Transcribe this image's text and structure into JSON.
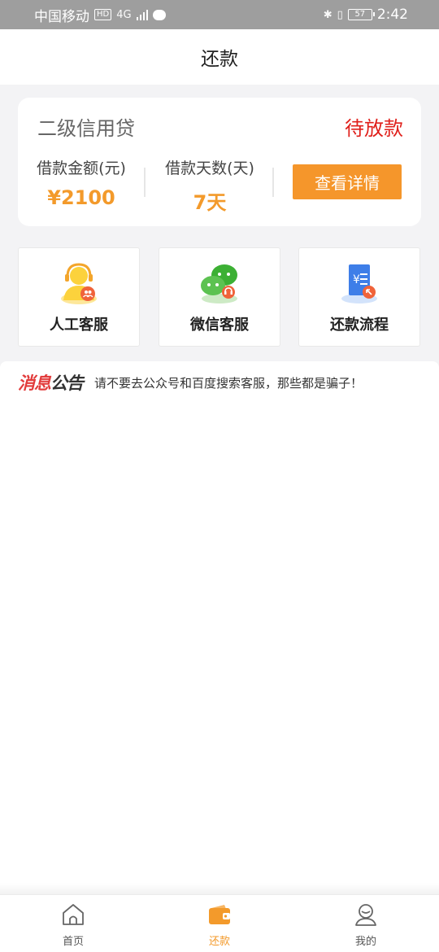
{
  "status_bar": {
    "carrier": "中国移动",
    "hd": "HD",
    "network": "4G",
    "battery": "57",
    "time": "2:42"
  },
  "header": {
    "title": "还款"
  },
  "loan": {
    "name": "二级信用贷",
    "status": "待放款",
    "amount_label": "借款金额(元)",
    "amount_value": "¥2100",
    "days_label": "借款天数(天)",
    "days_value": "7天",
    "detail_button": "查看详情"
  },
  "services": [
    {
      "label": "人工客服",
      "icon": "headset-agent-icon"
    },
    {
      "label": "微信客服",
      "icon": "wechat-icon"
    },
    {
      "label": "还款流程",
      "icon": "repayment-doc-icon"
    }
  ],
  "notice": {
    "logo_part1": "消息",
    "logo_part2": "公告",
    "text": "请不要去公众号和百度搜索客服，那些都是骗子！"
  },
  "tabbar": {
    "items": [
      {
        "label": "首页",
        "icon": "home-icon",
        "active": false
      },
      {
        "label": "还款",
        "icon": "wallet-icon",
        "active": true
      },
      {
        "label": "我的",
        "icon": "profile-icon",
        "active": false
      }
    ]
  },
  "colors": {
    "accent": "#f39a2b",
    "status_red": "#e0201b",
    "button_orange": "#f5962b",
    "background": "#f3f3f5"
  }
}
